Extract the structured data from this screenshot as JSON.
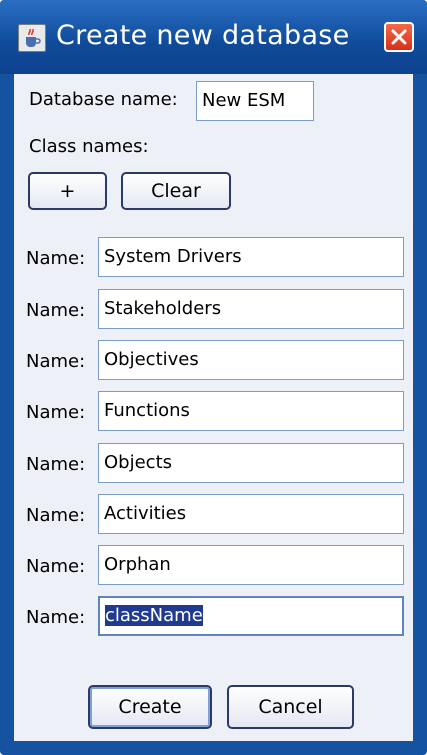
{
  "window": {
    "title": "Create new database"
  },
  "form": {
    "db_name_label": "Database name:",
    "db_name_value": "New ESM",
    "class_names_label": "Class names:",
    "add_label": "+",
    "clear_label": "Clear",
    "name_label": "Name:",
    "classes": [
      "System Drivers",
      "Stakeholders",
      "Objectives",
      "Functions",
      "Objects",
      "Activities",
      "Orphan",
      "className"
    ]
  },
  "footer": {
    "create_label": "Create",
    "cancel_label": "Cancel"
  },
  "colors": {
    "titlebar": "#1553a0",
    "content_bg": "#eef0f7",
    "selection": "#1f3a8f",
    "close": "#e04a2c"
  },
  "icons": [
    "java-cup-icon",
    "close-icon"
  ]
}
